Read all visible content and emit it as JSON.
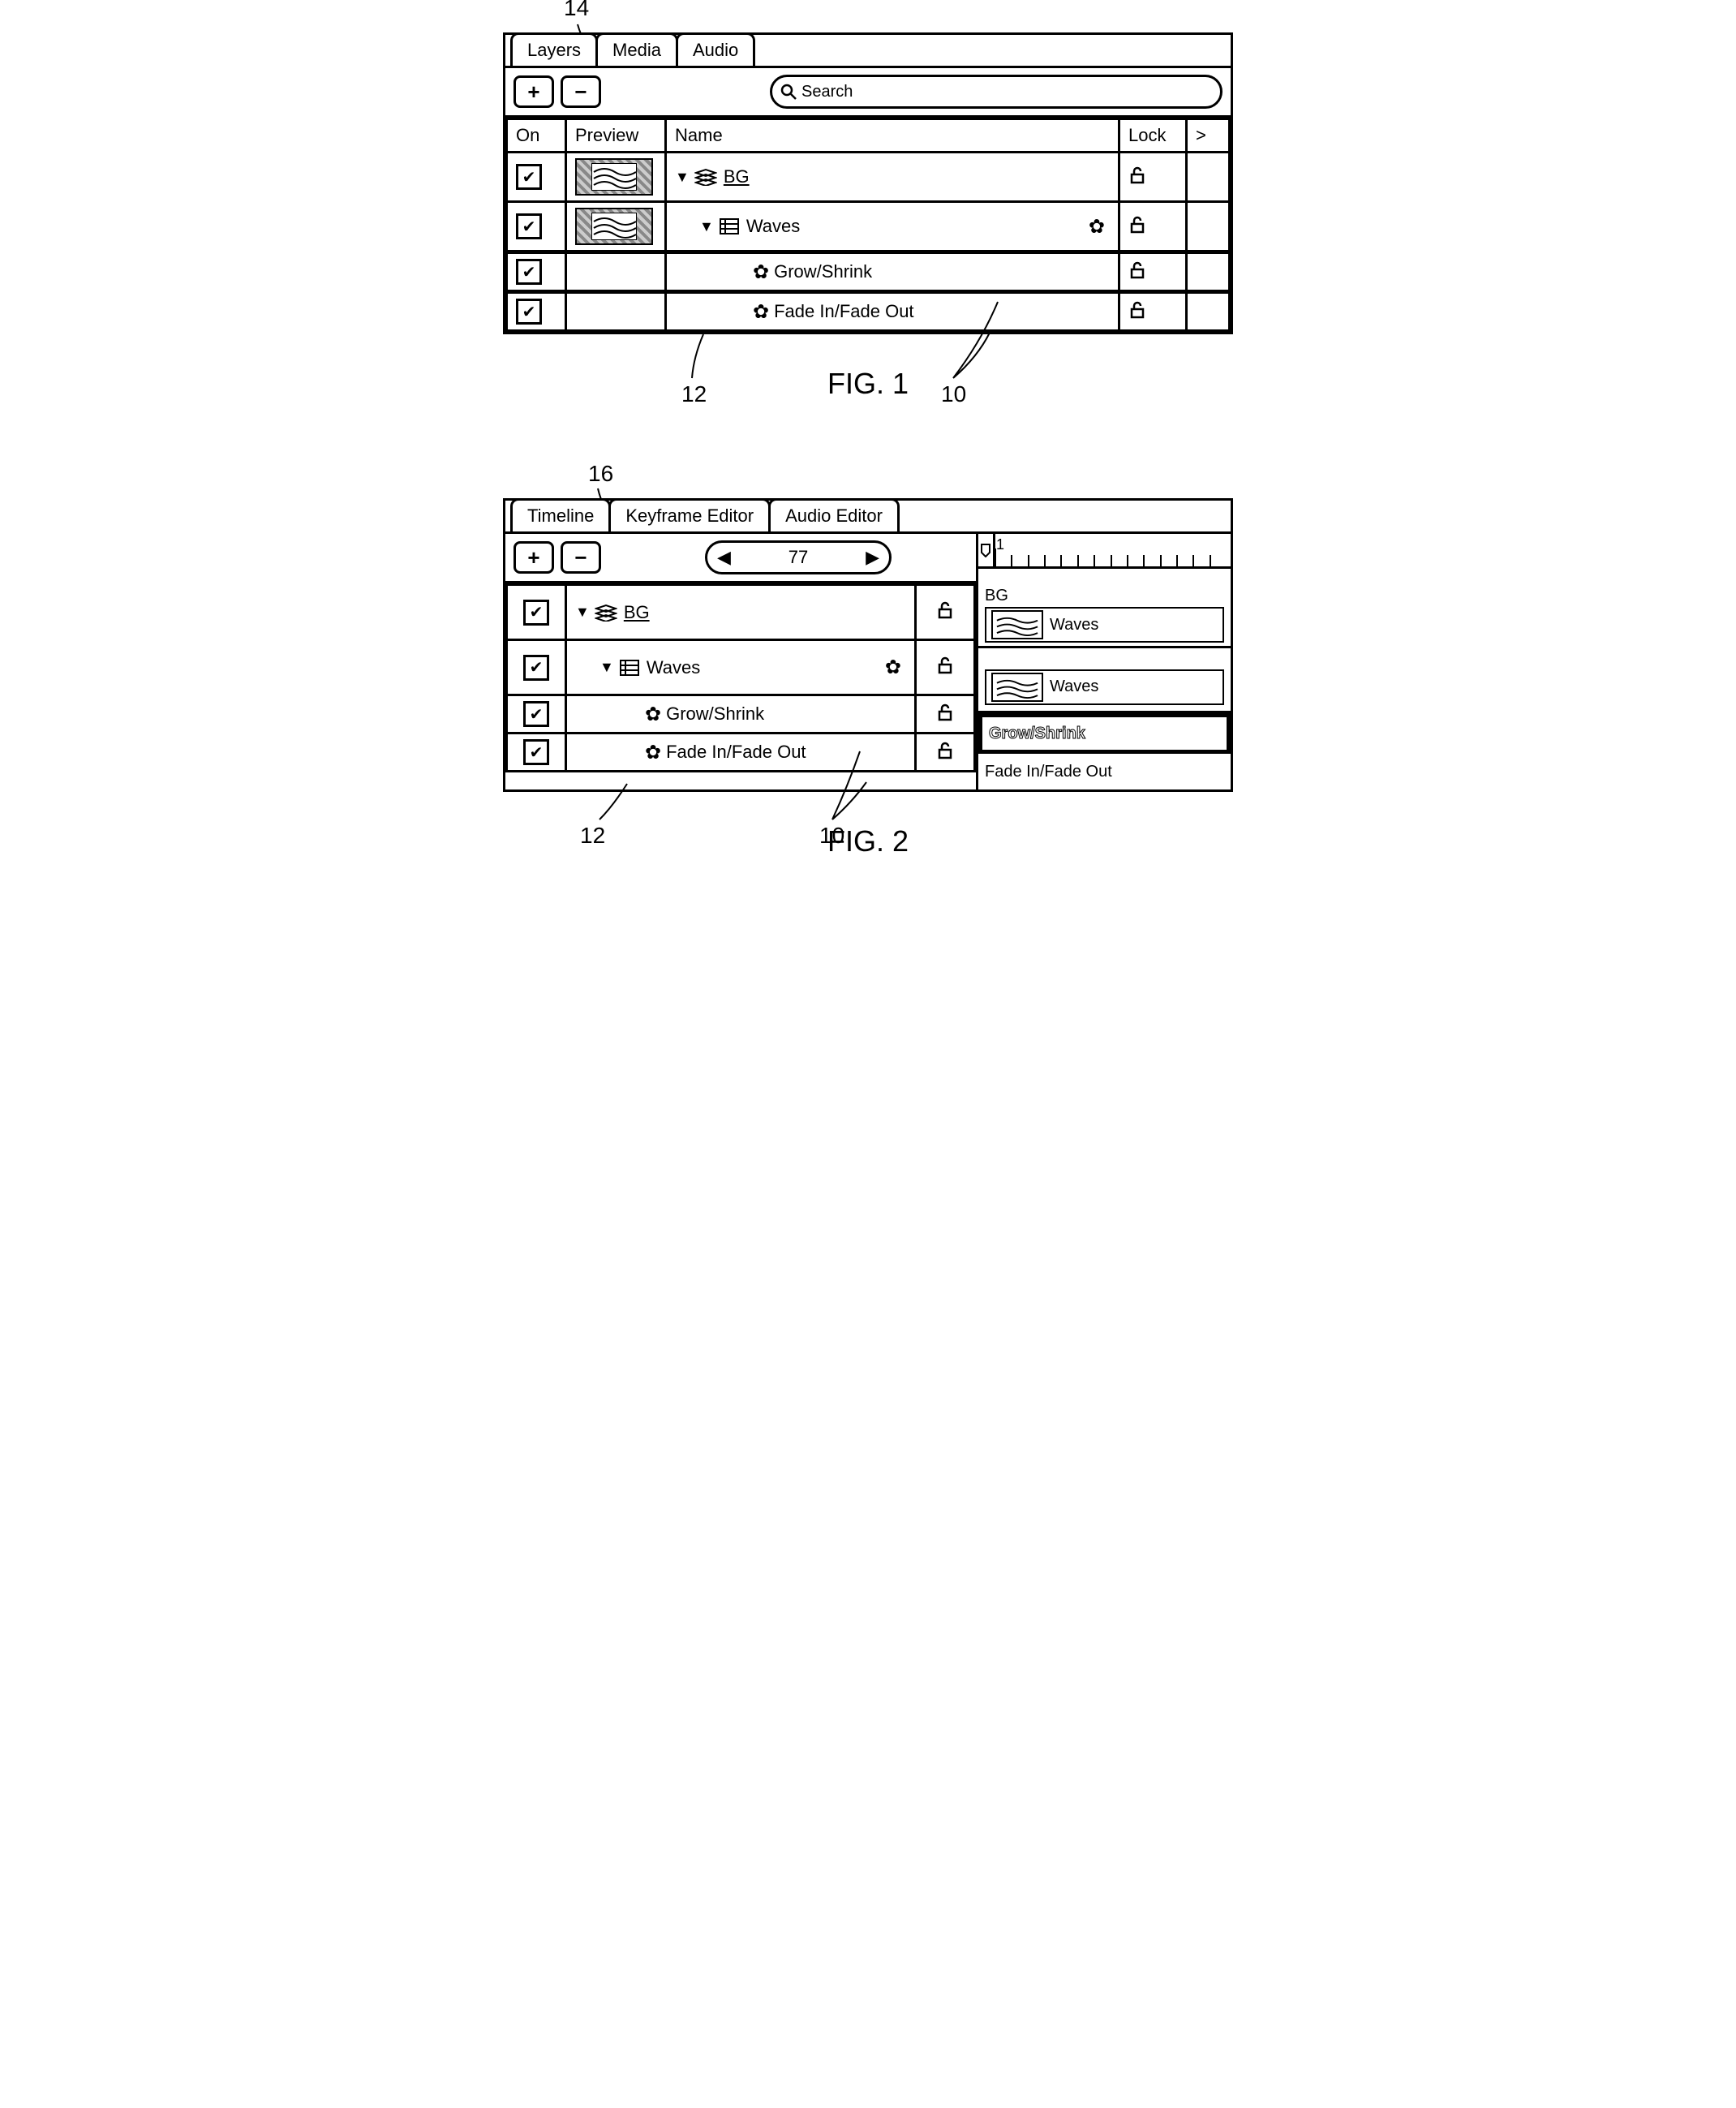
{
  "fig1": {
    "callout": "14",
    "tabs": [
      "Layers",
      "Media",
      "Audio"
    ],
    "searchLabel": "Search",
    "headers": {
      "on": "On",
      "preview": "Preview",
      "name": "Name",
      "lock": "Lock",
      "more": ">"
    },
    "rows": [
      {
        "name": "BG"
      },
      {
        "name": "Waves"
      },
      {
        "name": "Grow/Shrink"
      },
      {
        "name": "Fade In/Fade Out"
      }
    ],
    "annot12": "12",
    "annot10": "10",
    "caption": "FIG. 1"
  },
  "fig2": {
    "callout": "16",
    "tabs": [
      "Timeline",
      "Keyframe Editor",
      "Audio Editor"
    ],
    "frame": "77",
    "rulerLabel": "1",
    "rows": [
      {
        "name": "BG"
      },
      {
        "name": "Waves"
      },
      {
        "name": "Grow/Shrink"
      },
      {
        "name": "Fade In/Fade Out"
      }
    ],
    "right": {
      "bgLabel": "BG",
      "wavesLabel": "Waves",
      "growLabel": "Grow/Shrink",
      "fadeLabel": "Fade In/Fade Out"
    },
    "annot12": "12",
    "annot10": "10",
    "caption": "FIG. 2"
  }
}
